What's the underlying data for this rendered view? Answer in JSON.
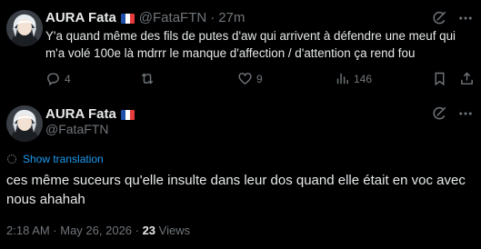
{
  "colors": {
    "background": "#000000",
    "text_primary": "#e7e9ea",
    "text_muted": "#71767b",
    "link": "#1d9bf0"
  },
  "reply_tweet": {
    "display_name": "AURA Fata",
    "flag_icon": "france-flag-icon",
    "handle": "@FataFTN",
    "separator": "·",
    "time": "27m",
    "text": "Y'a quand même des fils de putes d'aw qui arrivent à défendre une meuf qui m'a volé 100e là mdrrr le manque d'affection / d'attention ça rend fou",
    "actions": {
      "reply_count": "4",
      "retweet_count": "",
      "like_count": "9",
      "view_count": "146"
    }
  },
  "main_tweet": {
    "display_name": "AURA Fata",
    "flag_icon": "france-flag-icon",
    "handle": "@FataFTN",
    "translate_label": "Show translation",
    "text": "ces même suceurs qu'elle insulte dans leur dos quand elle était en voc avec nous ahahah",
    "timestamp": "2:18 AM · May 26, 2026 · ",
    "views_count": "23",
    "views_label": " Views"
  }
}
